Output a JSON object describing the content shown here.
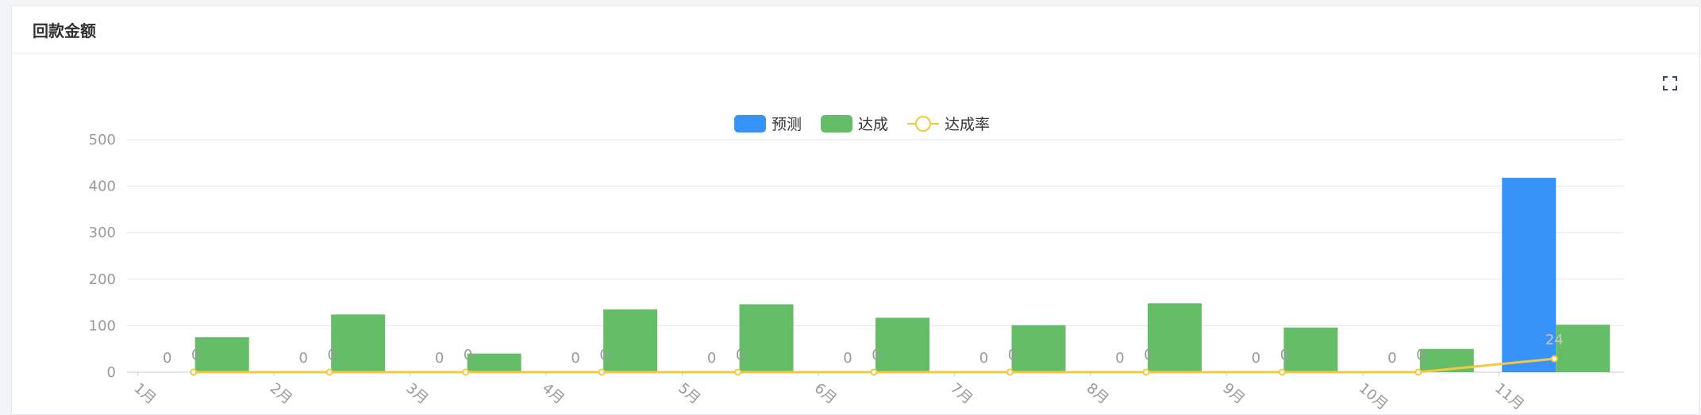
{
  "card": {
    "title": "回款金额"
  },
  "icons": {
    "fullscreen": "fullscreen-icon"
  },
  "colors": {
    "forecast": "#3793f7",
    "achieved": "#65be67",
    "rate": "#f5c842",
    "axis_text": "#999999",
    "grid": "#e6e6e6"
  },
  "chart_data": {
    "type": "bar",
    "categories": [
      "1月",
      "2月",
      "3月",
      "4月",
      "5月",
      "6月",
      "7月",
      "8月",
      "9月",
      "10月",
      "11月"
    ],
    "legend_position": "top-center",
    "ylim": [
      0,
      500
    ],
    "yticks": [
      0,
      100,
      200,
      300,
      400,
      500
    ],
    "grid": true,
    "series": [
      {
        "name": "预测",
        "kind": "bar",
        "values": [
          0,
          0,
          0,
          0,
          0,
          0,
          0,
          0,
          0,
          0,
          418
        ],
        "labels": [
          "0",
          "0",
          "0",
          "0",
          "0",
          "0",
          "0",
          "0",
          "0",
          "0",
          ""
        ]
      },
      {
        "name": "达成",
        "kind": "bar",
        "values": [
          75,
          124,
          40,
          135,
          146,
          117,
          101,
          148,
          96,
          50,
          102
        ],
        "labels": [
          "0",
          "0",
          "0",
          "0",
          "0",
          "0",
          "0",
          "0",
          "0",
          "0",
          ""
        ]
      },
      {
        "name": "达成率",
        "kind": "line",
        "values": [
          0,
          0,
          0,
          0,
          0,
          0,
          0,
          0,
          0,
          0,
          24
        ],
        "labels": [
          "",
          "",
          "",
          "",
          "",
          "",
          "",
          "",
          "",
          "",
          "24"
        ]
      }
    ]
  }
}
